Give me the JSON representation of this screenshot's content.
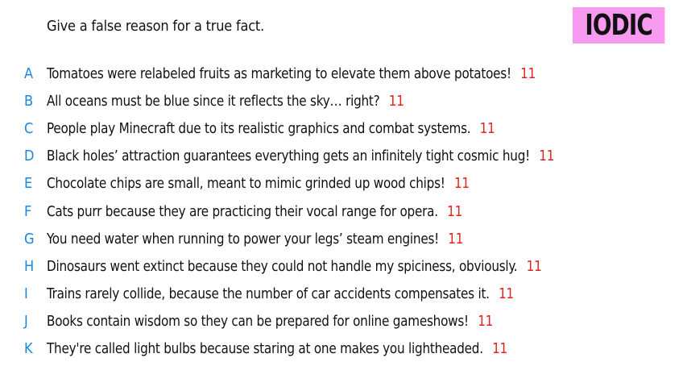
{
  "prompt": "Give a false reason for a true fact.",
  "logo": "IODIC",
  "answers": [
    {
      "letter": "A",
      "text": "Tomatoes were relabeled fruits as marketing to elevate them above potatoes!",
      "score": "11"
    },
    {
      "letter": "B",
      "text": "All oceans must be blue since it reflects the sky… right?",
      "score": "11"
    },
    {
      "letter": "C",
      "text": "People play Minecraft due to its realistic graphics and combat systems.",
      "score": "11"
    },
    {
      "letter": "D",
      "text": "Black holes’ attraction guarantees everything gets an infinitely tight cosmic hug!",
      "score": "11"
    },
    {
      "letter": "E",
      "text": "Chocolate chips are small, meant to mimic grinded up wood chips!",
      "score": "11"
    },
    {
      "letter": "F",
      "text": "Cats purr because they are practicing their vocal range for opera.",
      "score": "11"
    },
    {
      "letter": "G",
      "text": "You need water when running to power your legs’ steam engines!",
      "score": "11"
    },
    {
      "letter": "H",
      "text": "Dinosaurs went extinct because they could not handle my spiciness, obviously.",
      "score": "11"
    },
    {
      "letter": "I",
      "text": "Trains rarely collide, because the number of car accidents compensates it.",
      "score": "11"
    },
    {
      "letter": "J",
      "text": "Books contain wisdom so they can be prepared for online gameshows!",
      "score": "11"
    },
    {
      "letter": "K",
      "text": "They're called light bulbs because staring at one makes you lightheaded.",
      "score": "11"
    }
  ],
  "colors": {
    "letter": "#1a86e0",
    "score": "#e3231d",
    "logo_bg": "#f79af0"
  }
}
